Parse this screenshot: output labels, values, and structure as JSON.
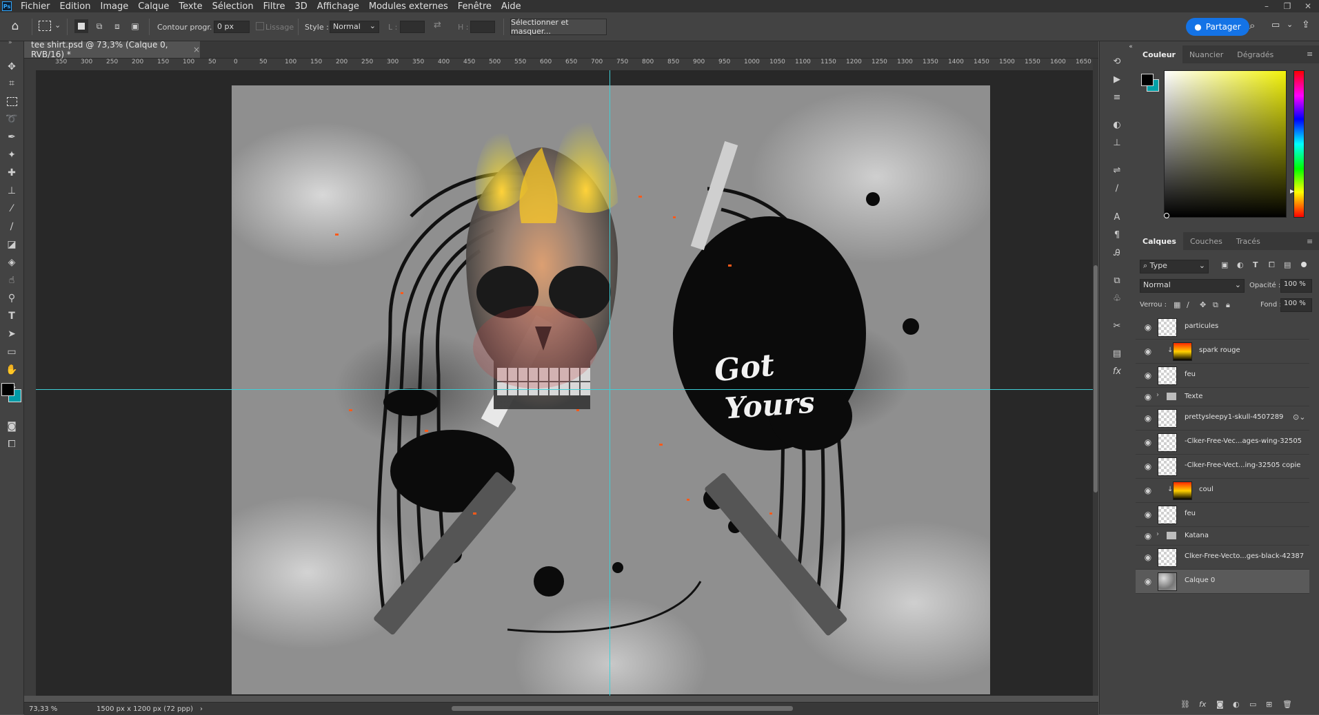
{
  "menu": [
    "Fichier",
    "Edition",
    "Image",
    "Calque",
    "Texte",
    "Sélection",
    "Filtre",
    "3D",
    "Affichage",
    "Modules externes",
    "Fenêtre",
    "Aide"
  ],
  "app_icon_label": "Ps",
  "options": {
    "feather_label": "Contour progr. :",
    "feather_value": "0 px",
    "antialias_label": "Lissage",
    "style_label": "Style :",
    "style_value": "Normal",
    "width_label": "L :",
    "height_label": "H :",
    "select_mask_button": "Sélectionner et masquer...",
    "share_button": "Partager"
  },
  "document": {
    "tab_title": "tee shirt.psd @ 73,3% (Calque 0, RVB/16) *",
    "close_symbol": "×"
  },
  "ruler_h": [
    "350",
    "300",
    "250",
    "200",
    "150",
    "100",
    "50",
    "0",
    "50",
    "100",
    "150",
    "200",
    "250",
    "300",
    "350",
    "400",
    "450",
    "500",
    "550",
    "600",
    "650",
    "700",
    "750",
    "800",
    "850",
    "900",
    "950",
    "1000",
    "1050",
    "1100",
    "1150",
    "1200",
    "1250",
    "1300",
    "1350",
    "1400",
    "1450",
    "1500",
    "1550",
    "1600",
    "1650"
  ],
  "status": {
    "zoom": "73,33 %",
    "doc_size": "1500 px x 1200 px (72 ppp)"
  },
  "canvas_text": {
    "line1": "Got",
    "line2": "Yours"
  },
  "color_panel": {
    "tabs": [
      "Couleur",
      "Nuancier",
      "Dégradés"
    ],
    "foreground": "#000000",
    "background": "#00a0a8"
  },
  "layers_panel": {
    "tabs": [
      "Calques",
      "Couches",
      "Tracés"
    ],
    "filter_kind": "Type",
    "blend_mode": "Normal",
    "opacity_label": "Opacité :",
    "opacity_value": "100 %",
    "lock_label": "Verrou :",
    "fill_label": "Fond :",
    "fill_value": "100 %",
    "layers": [
      {
        "name": "particules",
        "kind": "pixel"
      },
      {
        "name": "spark rouge",
        "kind": "gradient"
      },
      {
        "name": "feu",
        "kind": "pixel"
      },
      {
        "name": "Texte",
        "kind": "group"
      },
      {
        "name": "prettysleepy1-skull-4507289",
        "kind": "pixel"
      },
      {
        "name": "-Clker-Free-Vec...ages-wing-32505",
        "kind": "pixel"
      },
      {
        "name": "-Clker-Free-Vect...ing-32505 copie",
        "kind": "pixel"
      },
      {
        "name": "coul",
        "kind": "gradient"
      },
      {
        "name": "feu",
        "kind": "pixel"
      },
      {
        "name": "Katana",
        "kind": "group"
      },
      {
        "name": "Clker-Free-Vecto...ges-black-42387",
        "kind": "pixel"
      },
      {
        "name": "Calque 0",
        "kind": "cloud"
      }
    ]
  }
}
